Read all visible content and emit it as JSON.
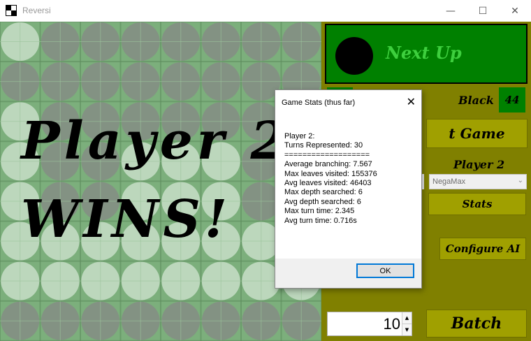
{
  "window": {
    "title": "Reversi",
    "minimize": "—",
    "maximize": "☐",
    "close": "✕"
  },
  "board": {
    "grid_rows": 8,
    "grid_cols": 8,
    "color": "#7caf7c",
    "disc_dark": "#839283",
    "disc_light": "#bcd7bc",
    "banner_line1": "Player 2",
    "banner_line2": "WINS!"
  },
  "panel": {
    "next_up_label": "Next Up",
    "next_up_color": "black",
    "black_label": "Black",
    "black_score": "44",
    "new_game_label": "t Game",
    "player2_label": "Player 2",
    "ai_select_value": "NegaMax",
    "stats_button": "Stats",
    "configure_ai_button": "Configure AI",
    "batch_count": "10",
    "batch_button": "Batch"
  },
  "dialog": {
    "title": "Game Stats (thus far)",
    "close_glyph": "✕",
    "lines": [
      "Player 2:",
      "Turns Represented: 30",
      "===================",
      "Average branching: 7.567",
      "Max leaves visited: 155376",
      "Avg leaves visited: 46403",
      "Max depth searched: 6",
      "Avg depth searched: 6",
      "Max turn time: 2.345",
      "Avg turn time: 0.716s"
    ],
    "ok_button": "OK"
  }
}
